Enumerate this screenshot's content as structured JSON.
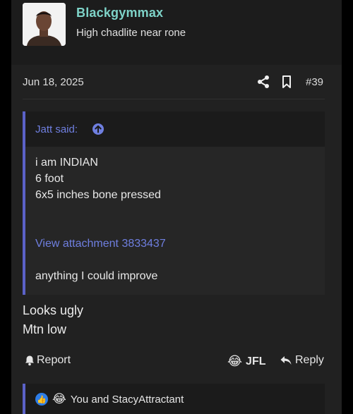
{
  "author": {
    "username": "Blackgymmax",
    "title": "High chadlite near rone"
  },
  "post": {
    "date": "Jun 18, 2025",
    "number": "#39",
    "share_icon": "share-icon",
    "bookmark_icon": "bookmark-icon"
  },
  "quote": {
    "author": "Jatt said:",
    "lines": [
      "i am INDIAN",
      "6 foot",
      "6x5 inches bone pressed"
    ],
    "attachment_link": "View attachment 3833437",
    "closing": "anything I could improve"
  },
  "reply": {
    "lines": [
      "Looks ugly",
      "Mtn low"
    ]
  },
  "actions": {
    "report_label": "Report",
    "jfl_emoji": "😂",
    "jfl_label": "JFL",
    "reply_label": "Reply"
  },
  "reactions": {
    "like_emoji": "👍",
    "laugh_emoji": "😂",
    "summary": "You and StacyAttractant"
  },
  "colors": {
    "username": "#7ed3c8",
    "link": "#6f7fe0",
    "quote_border": "#5b62c8"
  }
}
